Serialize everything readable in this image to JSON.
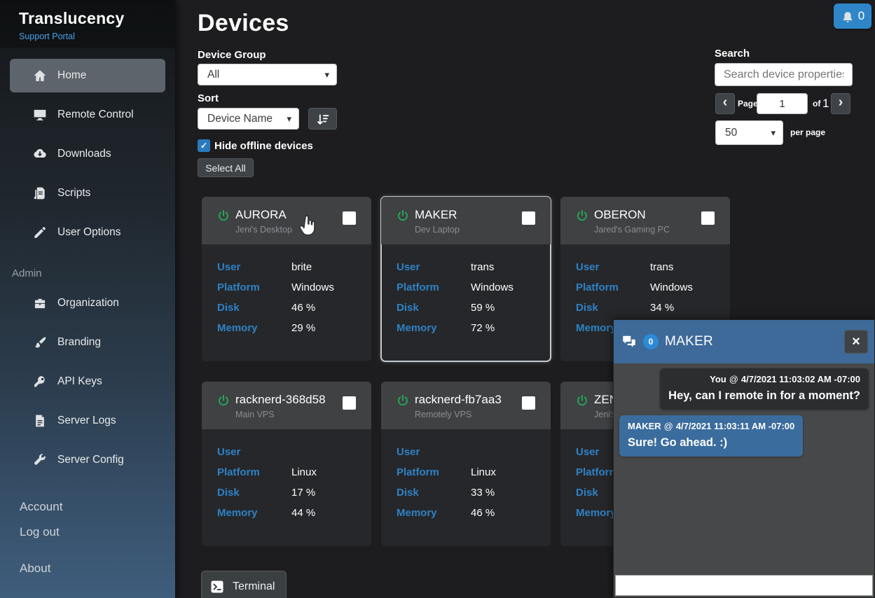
{
  "brand": {
    "title": "Translucency",
    "subtitle": "Support Portal"
  },
  "sidebar": {
    "items": [
      {
        "label": "Home",
        "active": true
      },
      {
        "label": "Remote Control"
      },
      {
        "label": "Downloads"
      },
      {
        "label": "Scripts"
      },
      {
        "label": "User Options"
      }
    ],
    "admin_label": "Admin",
    "admin_items": [
      {
        "label": "Organization"
      },
      {
        "label": "Branding"
      },
      {
        "label": "API Keys"
      },
      {
        "label": "Server Logs"
      },
      {
        "label": "Server Config"
      }
    ],
    "account_label": "Account",
    "logout_label": "Log out",
    "about_label": "About"
  },
  "header": {
    "title": "Devices"
  },
  "notifications": {
    "count": "0"
  },
  "filters": {
    "device_group_label": "Device Group",
    "device_group_value": "All",
    "sort_label": "Sort",
    "sort_value": "Device Name",
    "hide_offline_label": "Hide offline devices",
    "hide_offline_checked": true,
    "select_all_label": "Select All"
  },
  "search": {
    "label": "Search",
    "placeholder": "Search device properties",
    "page_label": "Page",
    "page_value": "1",
    "of_label": "of",
    "total_pages": "1",
    "per_page_value": "50",
    "per_page_label": "per page"
  },
  "device_labels": {
    "user": "User",
    "platform": "Platform",
    "disk": "Disk",
    "memory": "Memory"
  },
  "devices": [
    {
      "name": "AURORA",
      "alias": "Jeni's Desktop",
      "user": "brite",
      "platform": "Windows",
      "disk": "46 %",
      "memory": "29 %"
    },
    {
      "name": "MAKER",
      "alias": "Dev Laptop",
      "user": "trans",
      "platform": "Windows",
      "disk": "59 %",
      "memory": "72 %"
    },
    {
      "name": "OBERON",
      "alias": "Jared's Gaming PC",
      "user": "trans",
      "platform": "Windows",
      "disk": "34 %",
      "memory": ""
    },
    {
      "name": "racknerd-368d58",
      "alias": "Main VPS",
      "user": "",
      "platform": "Linux",
      "disk": "17 %",
      "memory": "44 %"
    },
    {
      "name": "racknerd-fb7aa3",
      "alias": "Remotely VPS",
      "user": "",
      "platform": "Linux",
      "disk": "33 %",
      "memory": "46 %"
    },
    {
      "name": "ZEN",
      "alias": "Jeni's",
      "user": "",
      "platform": "",
      "disk": "",
      "memory": ""
    }
  ],
  "chat": {
    "title": "MAKER",
    "badge": "0",
    "messages": [
      {
        "sender": "You",
        "sep": "@",
        "time": "4/7/2021 11:03:02 AM -07:00",
        "text": "Hey, can I remote in for a moment?"
      },
      {
        "sender": "MAKER",
        "sep": "@",
        "time": "4/7/2021 11:03:11 AM -07:00",
        "text": "Sure! Go ahead. :)"
      }
    ]
  },
  "terminal": {
    "label": "Terminal"
  },
  "icons": {
    "check": "✓",
    "close": "×",
    "prev": "‹",
    "next": "›",
    "chevron": "▾"
  },
  "colors": {
    "accent_blue": "#2e86c8",
    "label_blue": "#2e82c6",
    "chat_header": "#3d6a99",
    "power_green": "#23a95a",
    "page_bg": "#1d1d1f",
    "card_header": "#3f4143",
    "card_body": "#26272a"
  }
}
